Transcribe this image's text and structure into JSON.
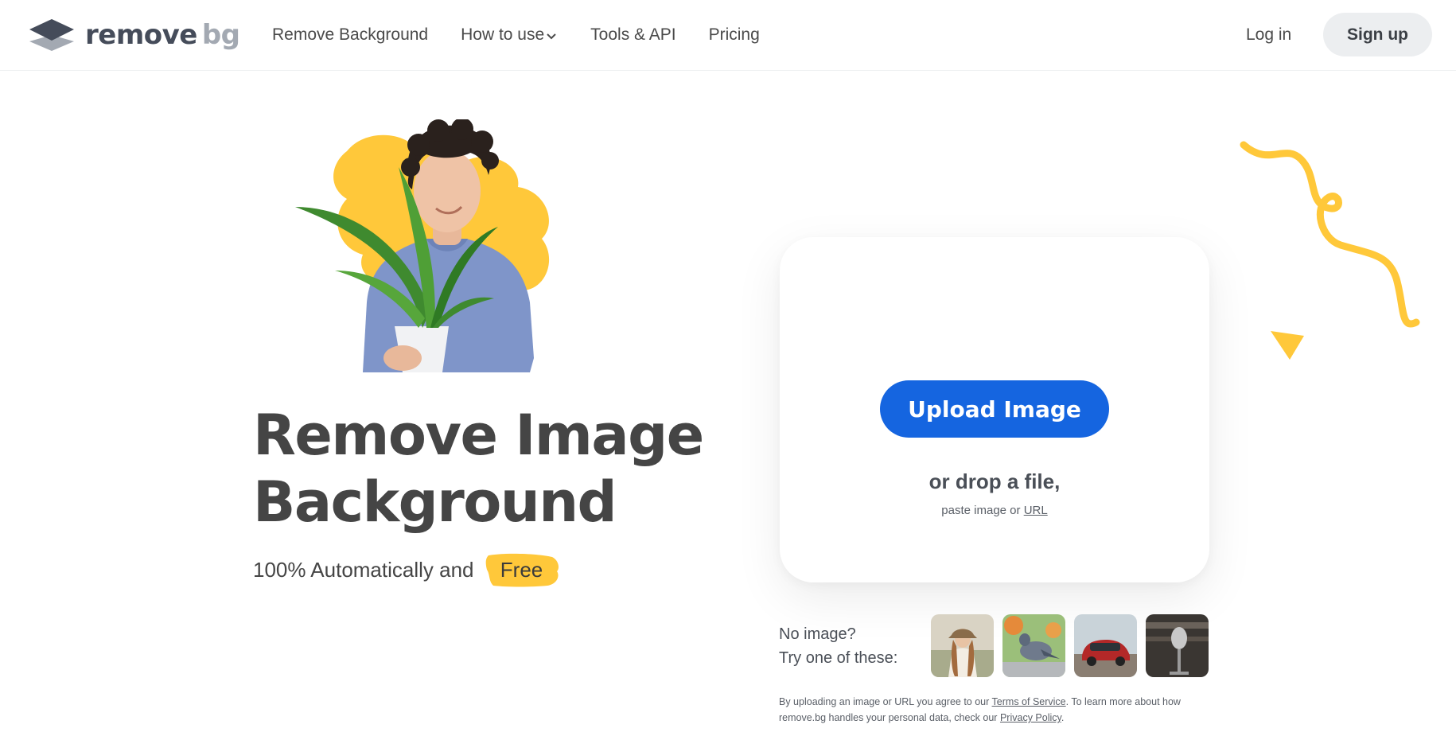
{
  "nav": {
    "logo_main": "remove",
    "logo_accent": "bg",
    "links": [
      "Remove Background",
      "How to use",
      "Tools & API",
      "Pricing"
    ],
    "login": "Log in",
    "signup": "Sign up"
  },
  "hero": {
    "title_line1": "Remove Image",
    "title_line2": "Background",
    "subtitle": "100% Automatically and",
    "free_badge": "Free"
  },
  "upload": {
    "button": "Upload Image",
    "drop_text": "or drop a file,",
    "paste_prefix": "paste image or",
    "url_link": "URL"
  },
  "samples": {
    "line1": "No image?",
    "line2": "Try one of these:",
    "items": [
      "sample-woman",
      "sample-pigeon",
      "sample-car",
      "sample-microphone"
    ]
  },
  "legal": {
    "part1": "By uploading an image or URL you agree to our",
    "terms": "Terms of Service",
    "part2": ". To learn more about how remove.bg handles your personal data, check our",
    "privacy": "Privacy Policy",
    "part3": "."
  },
  "colors": {
    "brand_blue": "#1565e0",
    "accent_yellow": "#ffc83a",
    "text_dark": "#454545",
    "signup_bg": "#eceef0"
  }
}
